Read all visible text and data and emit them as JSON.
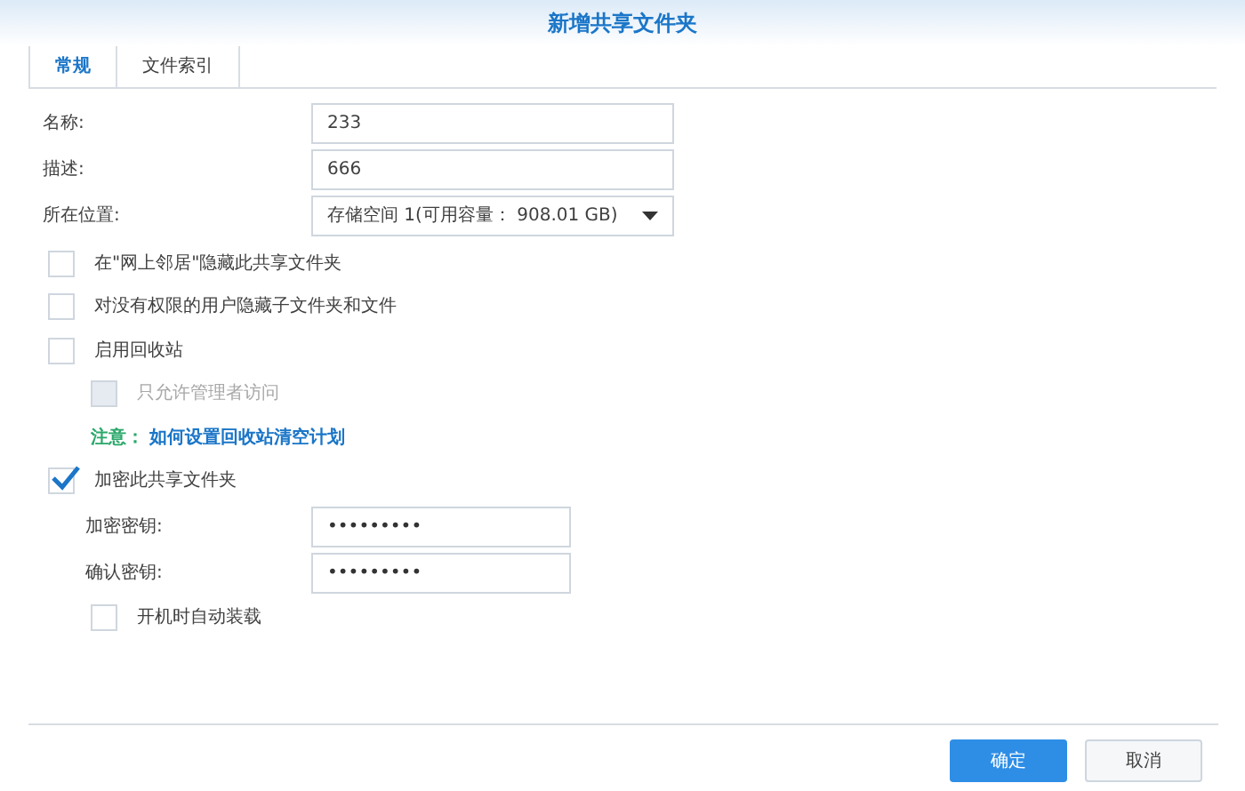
{
  "window": {
    "title": "新增共享文件夹"
  },
  "tabs": [
    {
      "label": "常规",
      "selected": true
    },
    {
      "label": "文件索引",
      "selected": false
    }
  ],
  "fields": [
    {
      "label": "名称:",
      "kind": "text",
      "value": "233"
    },
    {
      "label": "描述:",
      "kind": "text",
      "value": "666"
    },
    {
      "label": "所在位置:",
      "kind": "select",
      "value": "存储空间 1(可用容量： 908.01 GB)"
    }
  ],
  "options": [
    {
      "kind": "checkbox",
      "label": "在\"网上邻居\"隐藏此共享文件夹",
      "checked": false,
      "disabled": false,
      "indented": false
    },
    {
      "kind": "checkbox",
      "label": "对没有权限的用户隐藏子文件夹和文件",
      "checked": false,
      "disabled": false,
      "indented": false
    },
    {
      "kind": "checkbox",
      "label": "启用回收站",
      "checked": false,
      "disabled": false,
      "indented": false
    },
    {
      "kind": "checkbox",
      "label": "只允许管理者访问",
      "checked": false,
      "disabled": true,
      "indented": true
    },
    {
      "kind": "note",
      "label": "注意：",
      "link": "如何设置回收站清空计划"
    },
    {
      "kind": "checkbox",
      "label": "加密此共享文件夹",
      "checked": true,
      "disabled": false,
      "indented": false
    },
    {
      "kind": "password",
      "label": "加密密钥:",
      "value": "•••••••••"
    },
    {
      "kind": "password",
      "label": "确认密钥:",
      "value": "•••••••••"
    },
    {
      "kind": "checkbox",
      "label": "开机时自动装载",
      "checked": false,
      "disabled": false,
      "indented": true
    }
  ],
  "buttons": [
    {
      "label": "确定",
      "kind": "primary"
    },
    {
      "label": "取消",
      "kind": "secondary"
    }
  ]
}
